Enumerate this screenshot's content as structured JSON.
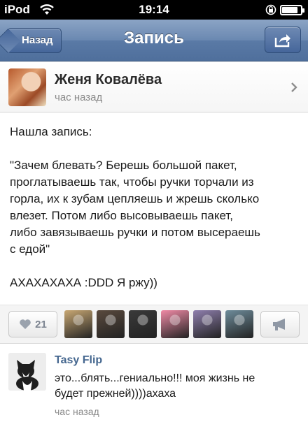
{
  "status_bar": {
    "carrier": "iPod",
    "time": "19:14",
    "battery_level": 0.85
  },
  "nav": {
    "back_label": "Назад",
    "title": "Запись"
  },
  "author": {
    "name": "Женя Ковалёва",
    "time": "час назад"
  },
  "post": {
    "lines_intro": [
      "Нашла запись:"
    ],
    "lines_quote": [
      "\"Зачем блевать? Берешь большой пакет,",
      "проглатываешь так, чтобы ручки торчали из",
      "горла, их к зубам цепляешь и жрешь сколько",
      "влезет. Потом либо высовываешь пакет,",
      "либо завязываешь ручки и потом высераешь",
      "с едой\""
    ],
    "lines_outro": [
      "АХАХАХАХА :DDD Я ржу))"
    ]
  },
  "actions": {
    "like_count": "21",
    "liker_colors": [
      "#c9a873",
      "#5a4a3e",
      "#3a3a3a",
      "#f08aa6",
      "#8f7fae",
      "#6e8c9b"
    ]
  },
  "comment": {
    "author": "Tasy Flip",
    "lines": [
      "это...блять...гениально!!! моя жизнь не",
      "будет прежней))))ахаха"
    ],
    "time": "час назад"
  },
  "colors": {
    "nav_blue": "#5a7aa6",
    "link_blue": "#45678f"
  }
}
